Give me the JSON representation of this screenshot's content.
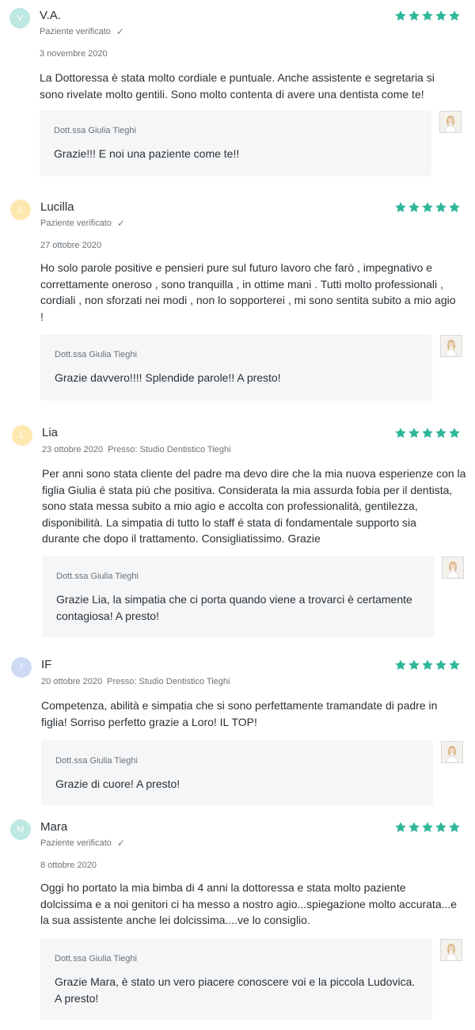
{
  "colors": {
    "star": "#2fb699",
    "avatar_mint": "#b7e6df",
    "avatar_yellow": "#fde7a8",
    "avatar_blue": "#c9d7f3"
  },
  "reviews": [
    {
      "initial": "V",
      "avatar_color": "#b7e6df",
      "name": "V.A.",
      "badge": "Paziente verificato",
      "date": "3 novembre 2020",
      "rating": 5,
      "text": [
        "La Dottoressa è stata molto cordiale e puntuale. Anche assistente e segretaria si",
        "sono rivelate molto gentili. Sono molto contenta di avere una dentista come te!"
      ],
      "reply_author": "Dott.ssa Giulia Tieghi",
      "reply_text": [
        "Grazie!!! E noi una paziente come te!!"
      ]
    },
    {
      "initial": "L",
      "avatar_color": "#fde7a8",
      "name": "Lucilla",
      "badge": "Paziente verificato",
      "date": "27 ottobre 2020",
      "rating": 5,
      "text": [
        "Ho solo parole positive e pensieri pure sul futuro lavoro che farò , impegnativo e",
        "correttamente oneroso , sono tranquilla , in ottime mani . Tutti molto professionali ,",
        "cordiali , non sforzati nei modi , non lo sopporterei , mi sono sentita subito a mio agio",
        "!"
      ],
      "reply_author": "Dott.ssa Giulia Tieghi",
      "reply_text": [
        "Grazie davvero!!!! Splendide parole!! A presto!"
      ]
    },
    {
      "initial": "L",
      "avatar_color": "#fde7a8",
      "name": "Lia",
      "meta_line": "23 ottobre 2020  Presso: Studio Dentistico Tieghi",
      "rating": 5,
      "text": [
        "Per anni sono stata cliente del padre ma devo dire che la mia nuova esperienze con la",
        "figlia Giulia é stata piú che positiva. Considerata la mia assurda fobia per il dentista,",
        "sono stata messa subito a mio agio e accolta con professionalità, gentilezza,",
        "disponibilità. La simpatia di tutto lo staff é stata di fondamentale supporto sia",
        "durante che dopo il trattamento. Consigliatissimo. Grazie"
      ],
      "reply_author": "Dott.ssa Giulia Tieghi",
      "reply_text": [
        "Grazie Lia, la simpatia che ci porta quando viene a trovarci è certamente",
        "contagiosa! A presto!"
      ]
    },
    {
      "initial": "I",
      "avatar_color": "#c9d7f3",
      "name": "IF",
      "meta_line": "20 ottobre 2020  Presso: Studio Dentistico Tieghi",
      "rating": 5,
      "text": [
        "Competenza, abilità e simpatia che si sono perfettamente tramandate di padre in",
        "figlia! Sorriso perfetto grazie a Loro! IL TOP!"
      ],
      "reply_author": "Dott.ssa Giulia Tieghi",
      "reply_text": [
        "Grazie di cuore! A presto!"
      ]
    },
    {
      "initial": "M",
      "avatar_color": "#b7e6df",
      "name": "Mara",
      "badge": "Paziente verificato",
      "date": "8 ottobre 2020",
      "rating": 5,
      "text": [
        "Oggi ho portato la mia bimba di 4 anni la dottoressa e stata molto paziente",
        "dolcissima e a noi genitori ci ha messo a nostro agio...spiegazione molto accurata...e",
        "la sua assistente anche lei dolcissima....ve lo consiglio."
      ],
      "reply_author": "Dott.ssa Giulia Tieghi",
      "reply_text": [
        "Grazie Mara, è stato un vero piacere conoscere voi e la piccola Ludovica.",
        "A presto!"
      ]
    }
  ]
}
